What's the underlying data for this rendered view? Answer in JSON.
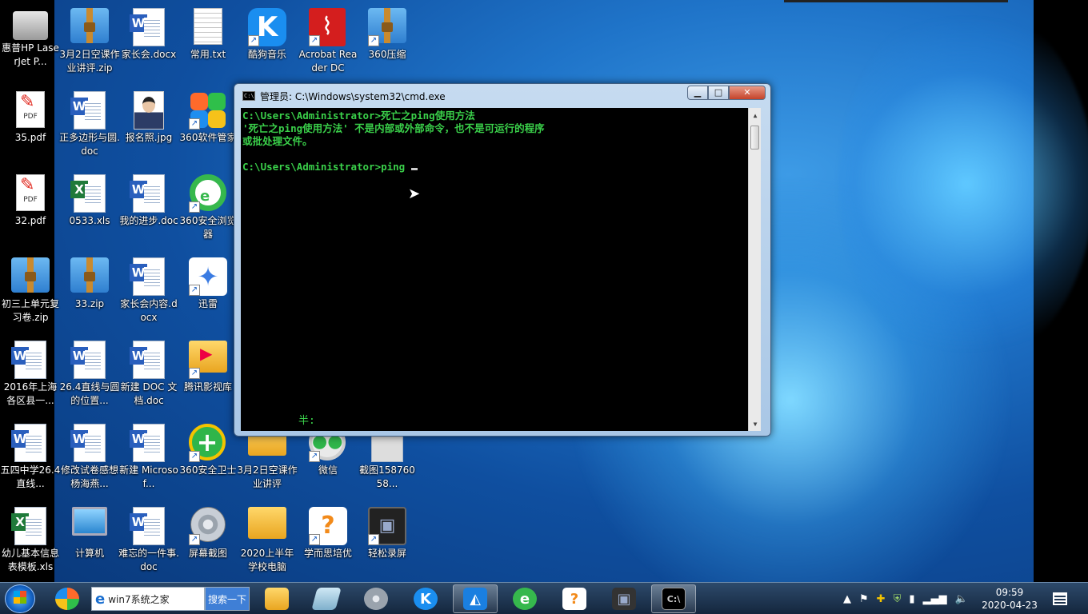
{
  "desktop": {
    "icons": [
      {
        "label": "惠普HP LaserJet P...",
        "kind": "printer"
      },
      {
        "label": "3月2日空课作业讲评.zip",
        "kind": "zip"
      },
      {
        "label": "家长会.docx",
        "kind": "word"
      },
      {
        "label": "常用.txt",
        "kind": "txt"
      },
      {
        "label": "酷狗音乐",
        "kind": "kugou"
      },
      {
        "label": "Acrobat Reader DC",
        "kind": "acrobat"
      },
      {
        "label": "360压缩",
        "kind": "zip"
      },
      {
        "label": "35.pdf",
        "kind": "pdf"
      },
      {
        "label": "正多边形与圆.doc",
        "kind": "word"
      },
      {
        "label": "报名照.jpg",
        "kind": "photo"
      },
      {
        "label": "360软件管家",
        "kind": "360soft"
      },
      {
        "label": "32.pdf",
        "kind": "pdf"
      },
      {
        "label": "0533.xls",
        "kind": "excel"
      },
      {
        "label": "我的进步.doc",
        "kind": "word"
      },
      {
        "label": "360安全浏览器",
        "kind": "360browser"
      },
      {
        "label": "初三上单元复习卷.zip",
        "kind": "zip"
      },
      {
        "label": "33.zip",
        "kind": "zip"
      },
      {
        "label": "家长会内容.docx",
        "kind": "word"
      },
      {
        "label": "迅雷",
        "kind": "thunder"
      },
      {
        "label": "2016年上海各区县一...",
        "kind": "word"
      },
      {
        "label": "26.4直线与圆的位置...",
        "kind": "word"
      },
      {
        "label": "新建 DOC 文档.doc",
        "kind": "word"
      },
      {
        "label": "腾讯影视库",
        "kind": "folder-video"
      },
      {
        "label": "五四中学26.4直线...",
        "kind": "word"
      },
      {
        "label": "修改试卷感想杨海燕...",
        "kind": "word"
      },
      {
        "label": "新建 Microsof...",
        "kind": "word"
      },
      {
        "label": "360安全卫士",
        "kind": "360guard"
      },
      {
        "label": "3月2日空课作业讲评",
        "kind": "folder"
      },
      {
        "label": "微信",
        "kind": "wechat"
      },
      {
        "label": "截图15876058...",
        "kind": "image"
      },
      {
        "label": "幼儿基本信息表模板.xls",
        "kind": "excel"
      },
      {
        "label": "计算机",
        "kind": "computer"
      },
      {
        "label": "难忘的一件事.doc",
        "kind": "word"
      },
      {
        "label": "屏幕截图",
        "kind": "disc"
      },
      {
        "label": "2020上半年学校电脑",
        "kind": "folder"
      },
      {
        "label": "学而思培优",
        "kind": "xes"
      },
      {
        "label": "轻松录屏",
        "kind": "recorder"
      }
    ]
  },
  "cmd": {
    "title": "管理员: C:\\Windows\\system32\\cmd.exe",
    "line1": "C:\\Users\\Administrator>死亡之ping使用方法",
    "line2": "'死亡之ping使用方法' 不是内部或外部命令，也不是可运行的程序",
    "line3": "或批处理文件。",
    "line4": "",
    "line5": "C:\\Users\\Administrator>ping ",
    "ime": "半:",
    "min_label": "▁",
    "max_label": "□",
    "close_label": "✕"
  },
  "taskbar": {
    "ie_text": "win7系统之家",
    "search_label": "搜索一下",
    "clock_time": "09:59",
    "clock_date": "2020-04-23"
  }
}
